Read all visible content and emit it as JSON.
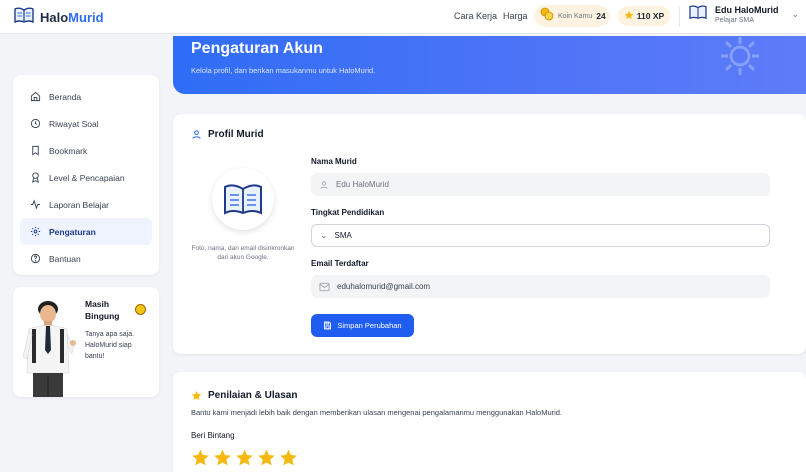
{
  "app": {
    "name_part1": "Halo",
    "name_part2": "Murid"
  },
  "nav": {
    "cara_kerja": "Cara Kerja",
    "harga": "Harga"
  },
  "coins": {
    "label": "Koin Kamu",
    "value": "24"
  },
  "xp": {
    "value": "110 XP"
  },
  "user": {
    "name": "Edu HaloMurid",
    "role": "Pelajar SMA"
  },
  "sidebar": {
    "items": [
      {
        "label": "Beranda",
        "icon": "home-icon"
      },
      {
        "label": "Riwayat Soal",
        "icon": "clock-icon"
      },
      {
        "label": "Bookmark",
        "icon": "bookmark-icon"
      },
      {
        "label": "Level & Pencapaian",
        "icon": "award-icon"
      },
      {
        "label": "Laporan Belajar",
        "icon": "activity-icon"
      },
      {
        "label": "Pengaturan",
        "icon": "gear-icon",
        "active": true
      },
      {
        "label": "Bantuan",
        "icon": "help-circle-icon"
      }
    ]
  },
  "help_card": {
    "title": "Masih Bingung",
    "body": "Tanya apa saja. HaloMurid siap bantu!"
  },
  "banner": {
    "title": "Pengaturan Akun",
    "subtitle": "Kelola profil, dan berikan masukanmu untuk HaloMurid."
  },
  "profile": {
    "title": "Profil Murid",
    "avatar_note": "Foto, nama, dan email disinkronkan dari akun Google.",
    "name_label": "Nama Murid",
    "name_value": "Edu HaloMurid",
    "level_label": "Tingkat Pendidikan",
    "level_value": "SMA",
    "email_label": "Email Terdaftar",
    "email_value": "eduhalomurid@gmail.com",
    "save_label": "Simpan Perubahan"
  },
  "review": {
    "title": "Penilaian & Ulasan",
    "subtitle": "Bantu kami menjadi lebih baik dengan memberikan ulasan mengenai pengalamanmu menggunakan HaloMurid.",
    "stars_label": "Beri Bintang",
    "rating": 5,
    "max_rating": 5
  },
  "colors": {
    "accent": "#2f6df6",
    "star": "#f5b90f",
    "active_bg": "#eef3fe"
  }
}
